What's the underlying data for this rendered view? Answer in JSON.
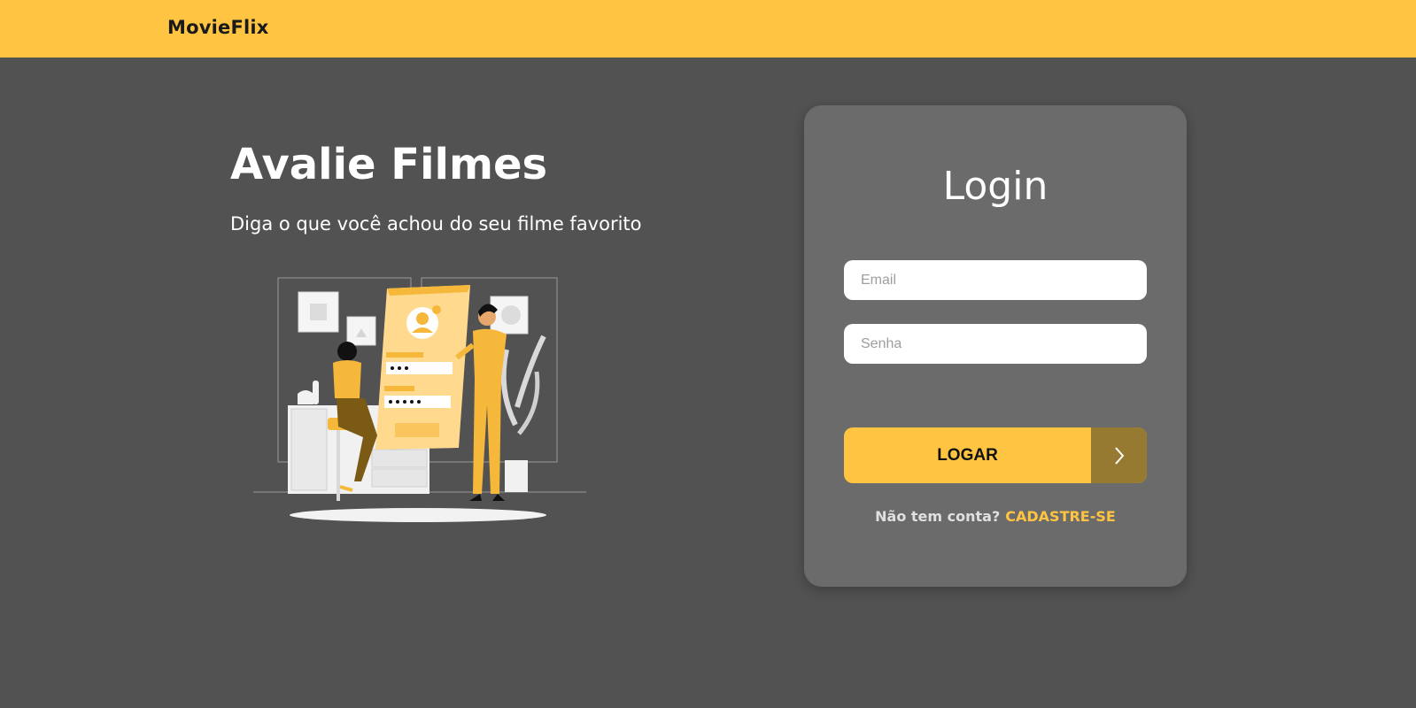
{
  "navbar": {
    "brand": "MovieFlix"
  },
  "hero": {
    "title": "Avalie Filmes",
    "subtitle": "Diga o que você achou do seu filme favorito"
  },
  "login": {
    "title": "Login",
    "email_placeholder": "Email",
    "password_placeholder": "Senha",
    "submit_label": "LOGAR",
    "submit_icon": "chevron-right-icon",
    "signup_prompt": "Não tem conta?",
    "signup_link": "CADASTRE-SE"
  },
  "colors": {
    "accent": "#FFC442",
    "background": "#525252",
    "card": "#6b6b6b",
    "button_arrow": "#977a31"
  }
}
